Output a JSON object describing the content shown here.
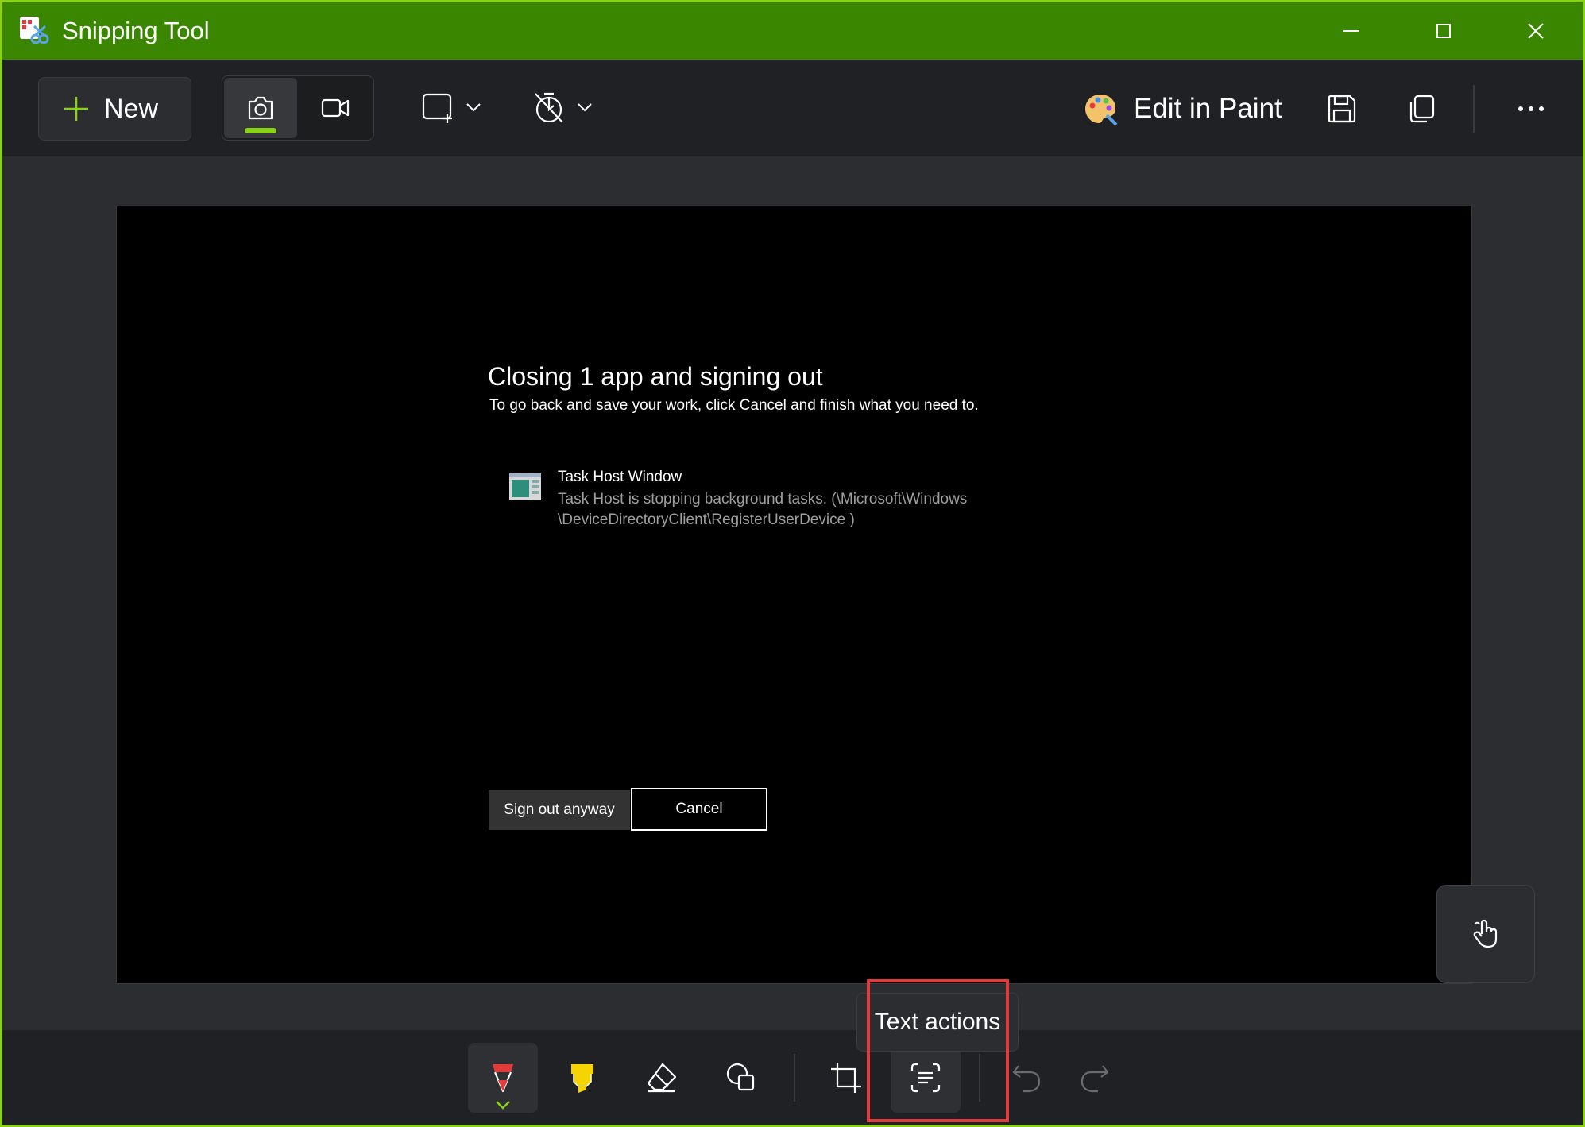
{
  "window": {
    "title": "Snipping Tool",
    "accent_color": "#3a8600"
  },
  "toolbar": {
    "new_label": "New",
    "edit_in_paint_label": "Edit in Paint",
    "icons": [
      "camera-icon",
      "video-icon",
      "rectangle-snip-icon",
      "timer-icon",
      "paint-palette-icon",
      "save-icon",
      "copy-icon",
      "more-icon"
    ]
  },
  "screenshot": {
    "dialog_title": "Closing 1 app and signing out",
    "dialog_subtitle": "To go back and save your work, click Cancel and finish what you need to.",
    "app_name": "Task Host Window",
    "app_desc_line1": "Task Host is stopping background tasks. (\\Microsoft\\Windows",
    "app_desc_line2": "\\DeviceDirectoryClient\\RegisterUserDevice )",
    "sign_out_label": "Sign out anyway",
    "cancel_label": "Cancel"
  },
  "tooltip": {
    "text": "Text actions"
  },
  "bottom_toolbar": {
    "tools": [
      "ballpoint-pen",
      "highlighter",
      "eraser",
      "shapes",
      "crop",
      "text-actions",
      "undo",
      "redo"
    ],
    "highlight_color": "#e03c3c"
  }
}
